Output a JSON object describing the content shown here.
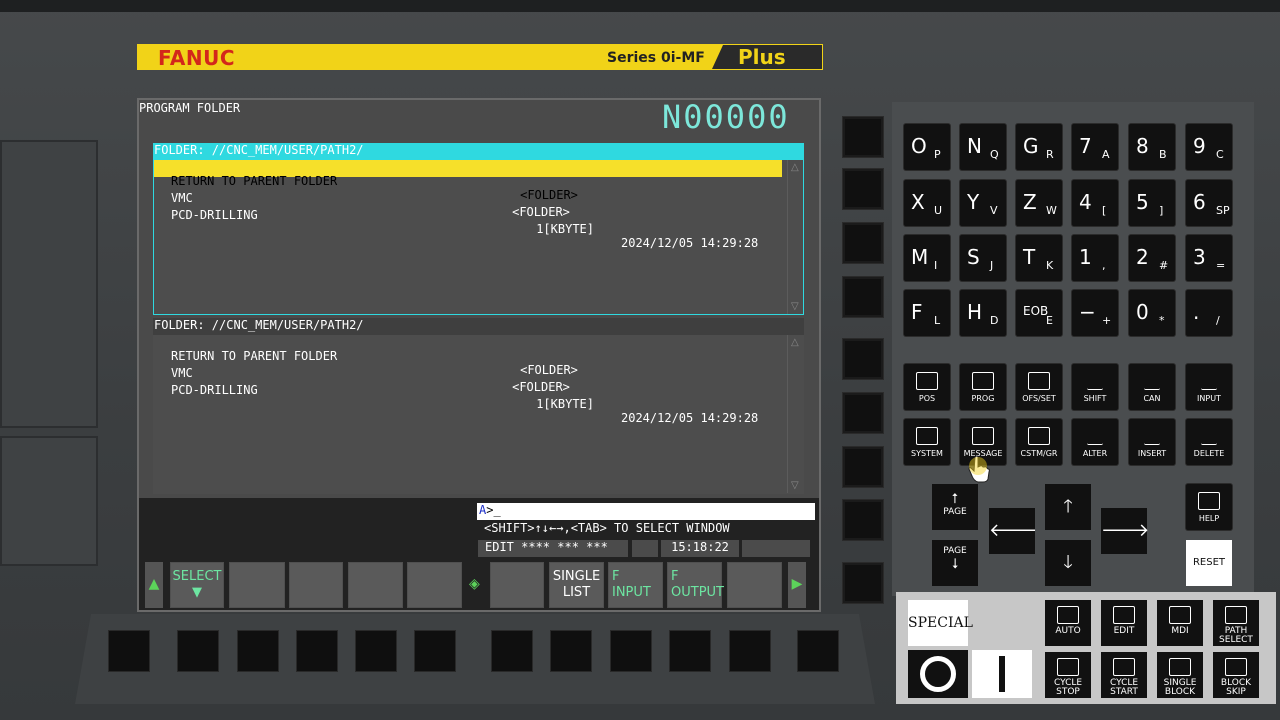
{
  "brand": {
    "name": "FANUC",
    "series": "Series 0i-MF",
    "plus": "Plus"
  },
  "screen": {
    "title": "PROGRAM FOLDER",
    "program_number": "N00000",
    "panel1": {
      "header": "FOLDER: //CNC_MEM/USER/PATH2/",
      "rows": [
        {
          "name": "RETURN TO PARENT FOLDER",
          "type": "<FOLDER>",
          "size": "",
          "date": ""
        },
        {
          "name": "VMC",
          "type": "<FOLDER>",
          "size": "",
          "date": ""
        },
        {
          "name": "PCD-DRILLING",
          "type": "",
          "size": "1[KBYTE]",
          "date": "2024/12/05 14:29:28"
        }
      ]
    },
    "panel2": {
      "header": "FOLDER: //CNC_MEM/USER/PATH2/",
      "rows": [
        {
          "name": "RETURN TO PARENT FOLDER",
          "type": "<FOLDER>",
          "size": "",
          "date": ""
        },
        {
          "name": "VMC",
          "type": "<FOLDER>",
          "size": "",
          "date": ""
        },
        {
          "name": "PCD-DRILLING",
          "type": "",
          "size": "1[KBYTE]",
          "date": "2024/12/05 14:29:28"
        }
      ]
    },
    "cmd_prefix": "A",
    "cmd_rest": ">_",
    "hint": "<SHIFT>↑↓←→,<TAB> TO SELECT WINDOW",
    "status_mode": "EDIT **** *** ***",
    "status_time": "15:18:22",
    "softkeys": {
      "select": "SELECT",
      "single_list_1": "SINGLE",
      "single_list_2": "LIST",
      "f_input_1": "F",
      "f_input_2": "INPUT",
      "f_output_1": "F",
      "f_output_2": "OUTPUT"
    }
  },
  "keypad": {
    "address_keys": [
      [
        "O",
        "P"
      ],
      [
        "N",
        "Q"
      ],
      [
        "G",
        "R"
      ],
      [
        "7",
        "A"
      ],
      [
        "8",
        "B"
      ],
      [
        "9",
        "C"
      ],
      [
        "X",
        "U"
      ],
      [
        "Y",
        "V"
      ],
      [
        "Z",
        "W"
      ],
      [
        "4",
        "["
      ],
      [
        "5",
        "]"
      ],
      [
        "6",
        "SP"
      ],
      [
        "M",
        "I"
      ],
      [
        "S",
        "J"
      ],
      [
        "T",
        "K"
      ],
      [
        "1",
        ","
      ],
      [
        "2",
        "#"
      ],
      [
        "3",
        "="
      ],
      [
        "F",
        "L"
      ],
      [
        "H",
        "D"
      ],
      [
        "EOB",
        "E"
      ],
      [
        "−",
        "+"
      ],
      [
        "0",
        "*"
      ],
      [
        ".",
        "/"
      ]
    ],
    "function_keys": [
      "POS",
      "PROG",
      "OFS/SET",
      "SHIFT",
      "CAN",
      "INPUT",
      "SYSTEM",
      "MESSAGE",
      "CSTM/GR",
      "ALTER",
      "INSERT",
      "DELETE"
    ],
    "page_up": "PAGE",
    "page_down": "PAGE",
    "help": "HELP",
    "reset": "RESET"
  },
  "mode_panel": {
    "special": "SPECIAL",
    "keys": [
      "AUTO",
      "EDIT",
      "MDI",
      "PATH SELECT",
      "CYCLE STOP",
      "CYCLE START",
      "SINGLE BLOCK",
      "BLOCK SKIP"
    ]
  }
}
